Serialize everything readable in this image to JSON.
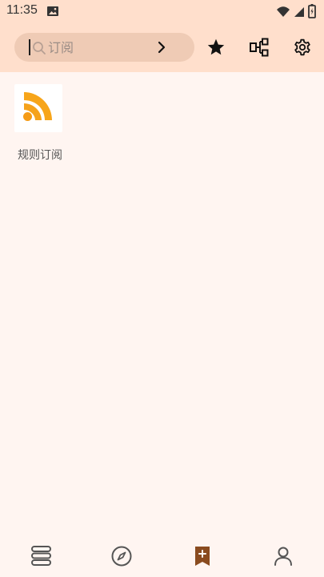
{
  "status_bar": {
    "time": "11:35",
    "icons": [
      "image-icon",
      "wifi-icon",
      "signal-icon",
      "battery-icon"
    ]
  },
  "search": {
    "placeholder": "订阅",
    "value": ""
  },
  "toolbar": {
    "icons": [
      "star-icon",
      "group-icon",
      "gear-icon"
    ]
  },
  "sources": [
    {
      "label": "规则订阅",
      "icon": "rss-icon"
    }
  ],
  "bottom_nav": {
    "items": [
      {
        "icon": "bookshelf-icon"
      },
      {
        "icon": "compass-icon"
      },
      {
        "icon": "rss-bookmark-icon"
      },
      {
        "icon": "person-icon"
      }
    ]
  },
  "colors": {
    "header": "#ffdfcc",
    "search_bg": "#efcbb5",
    "background": "#fff5f1",
    "accent": "#8a4b1f",
    "rss_orange": "#f7a51a"
  }
}
